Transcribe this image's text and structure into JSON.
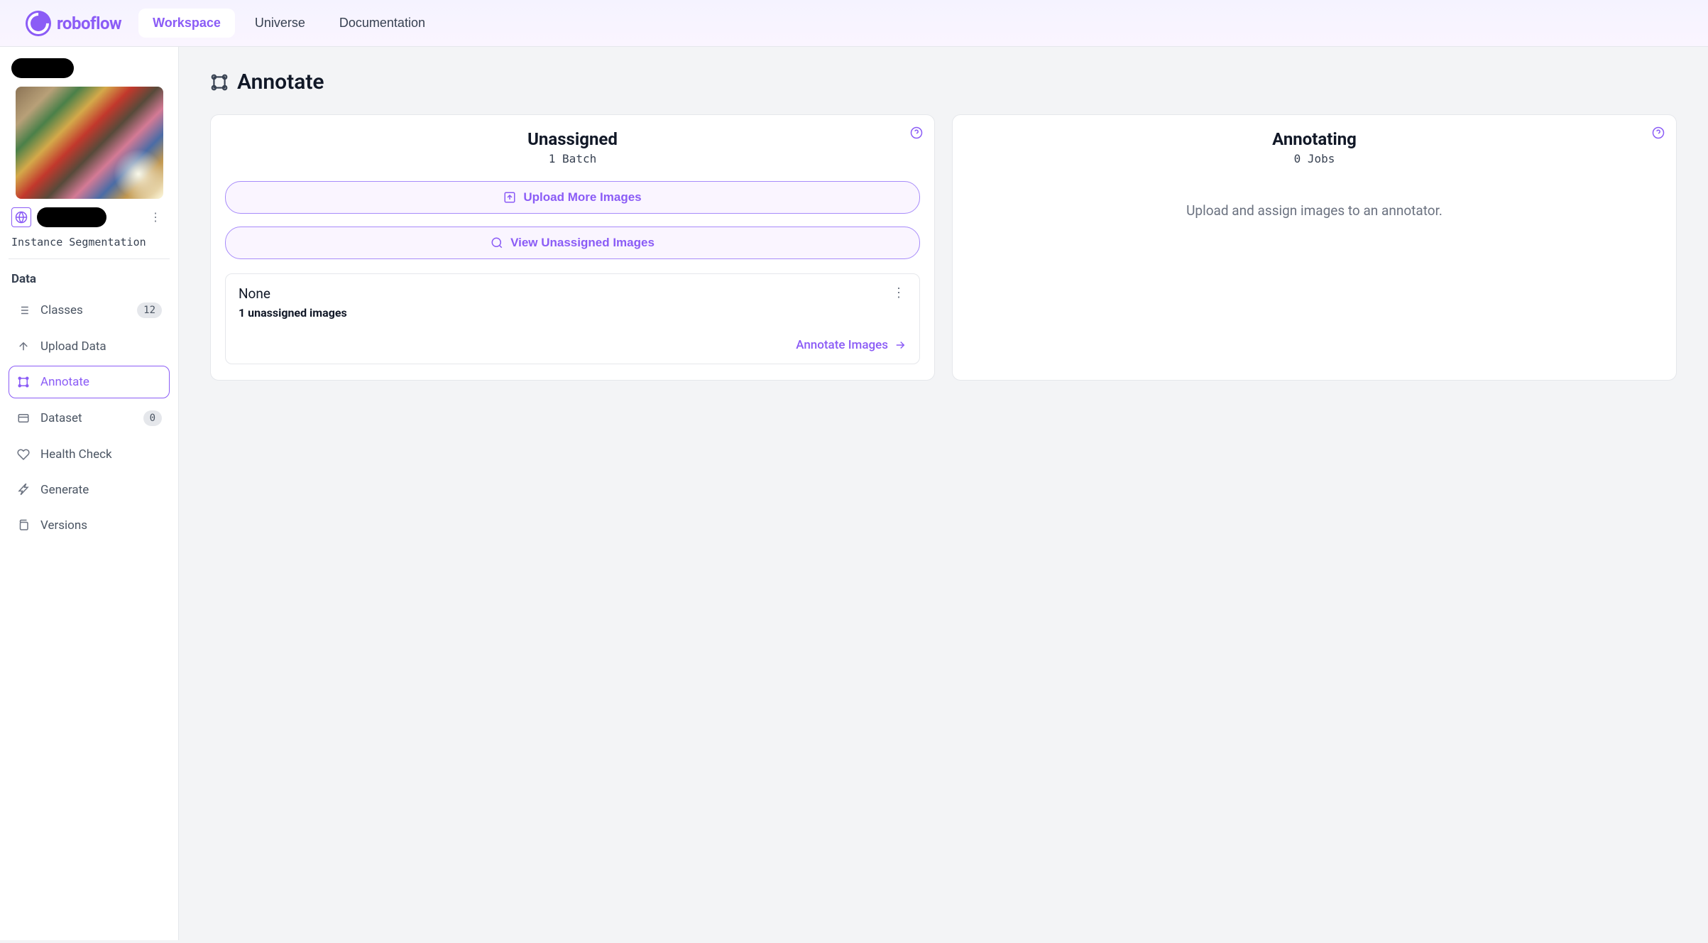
{
  "brand": "roboflow",
  "nav": {
    "tabs": [
      {
        "label": "Workspace",
        "active": true
      },
      {
        "label": "Universe",
        "active": false
      },
      {
        "label": "Documentation",
        "active": false
      }
    ]
  },
  "sidebar": {
    "project_type": "Instance Segmentation",
    "section_heading": "Data",
    "items": [
      {
        "label": "Classes",
        "badge": "12",
        "icon": "list-icon",
        "active": false
      },
      {
        "label": "Upload Data",
        "badge": null,
        "icon": "upload-icon",
        "active": false
      },
      {
        "label": "Annotate",
        "badge": null,
        "icon": "annotate-icon",
        "active": true
      },
      {
        "label": "Dataset",
        "badge": "0",
        "icon": "dataset-icon",
        "active": false
      },
      {
        "label": "Health Check",
        "badge": null,
        "icon": "health-icon",
        "active": false
      },
      {
        "label": "Generate",
        "badge": null,
        "icon": "generate-icon",
        "active": false
      },
      {
        "label": "Versions",
        "badge": null,
        "icon": "versions-icon",
        "active": false
      }
    ]
  },
  "page": {
    "title": "Annotate"
  },
  "cards": {
    "unassigned": {
      "title": "Unassigned",
      "subtitle": "1 Batch",
      "upload_btn": "Upload More Images",
      "view_btn": "View Unassigned Images",
      "batch": {
        "name": "None",
        "count": "1 unassigned images",
        "action": "Annotate Images"
      }
    },
    "annotating": {
      "title": "Annotating",
      "subtitle": "0 Jobs",
      "empty_text": "Upload and assign images to an annotator."
    }
  }
}
